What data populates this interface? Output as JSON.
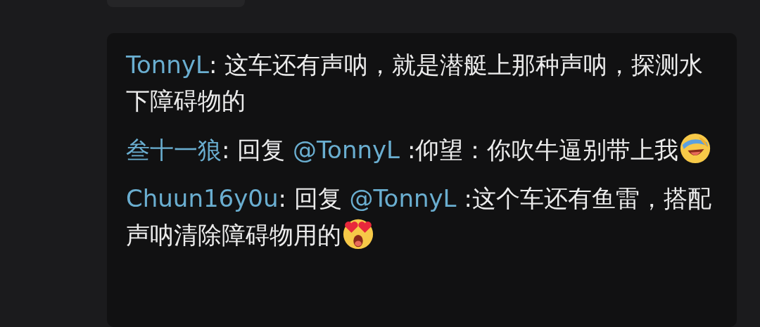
{
  "top_card": {
    "kind": "card"
  },
  "comments": [
    {
      "author": "TonnyL",
      "separator": ":",
      "text": "这车还有声呐，就是潜艇上那种声呐，探测水下障碍物的"
    },
    {
      "author": "叁十一狼",
      "separator": ":",
      "reply_label": "回复",
      "mention": "@TonnyL",
      "text": ":仰望：你吹牛逼别带上我",
      "emoji": {
        "kind": "laughing"
      }
    },
    {
      "author": "Chuun16y0u",
      "separator": ":",
      "reply_label": "回复",
      "mention": "@TonnyL",
      "text": ":这个车还有鱼雷，搭配声呐清除障碍物用的",
      "emoji": {
        "kind": "heart-eyes"
      }
    }
  ]
}
